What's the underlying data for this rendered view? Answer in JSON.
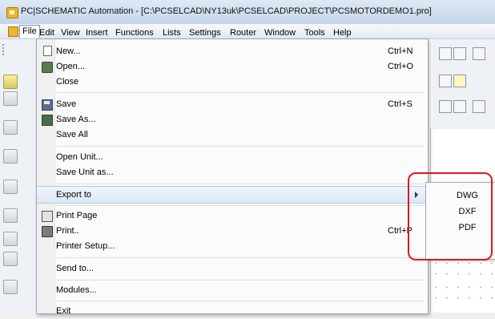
{
  "window": {
    "title": "PC|SCHEMATIC Automation - [C:\\PCSELCAD\\NY13uk\\PCSELCAD\\PROJECT\\PCSMOTORDEMO1.pro]"
  },
  "menubar": [
    "File",
    "Edit",
    "View",
    "Insert",
    "Functions",
    "Lists",
    "Settings",
    "Router",
    "Window",
    "Tools",
    "Help"
  ],
  "file_menu": {
    "new": {
      "label": "New...",
      "shortcut": "Ctrl+N"
    },
    "open": {
      "label": "Open...",
      "shortcut": "Ctrl+O"
    },
    "close": {
      "label": "Close"
    },
    "save": {
      "label": "Save",
      "shortcut": "Ctrl+S"
    },
    "save_as": {
      "label": "Save As..."
    },
    "save_all": {
      "label": "Save All"
    },
    "open_unit": {
      "label": "Open Unit..."
    },
    "save_unit_as": {
      "label": "Save Unit as..."
    },
    "export_to": {
      "label": "Export to"
    },
    "print_page": {
      "label": "Print Page"
    },
    "print": {
      "label": "Print..",
      "shortcut": "Ctrl+P"
    },
    "printer_setup": {
      "label": "Printer Setup..."
    },
    "send_to": {
      "label": "Send to..."
    },
    "modules": {
      "label": "Modules..."
    },
    "exit": {
      "label": "Exit"
    }
  },
  "export_submenu": [
    "DWG",
    "DXF",
    "PDF"
  ],
  "colors": {
    "highlight": "#dde8f5",
    "callout": "#e0181d",
    "menu_border": "#97a6bc"
  }
}
